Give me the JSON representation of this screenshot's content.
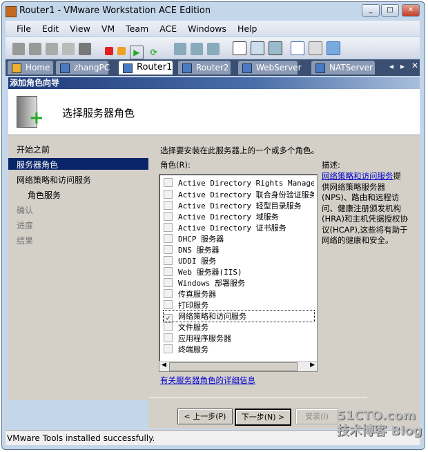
{
  "window": {
    "title": "Router1 - VMware Workstation ACE Edition"
  },
  "menu": [
    "File",
    "Edit",
    "View",
    "VM",
    "Team",
    "ACE",
    "Windows",
    "Help"
  ],
  "tabs": [
    {
      "label": "Home"
    },
    {
      "label": "zhangPC"
    },
    {
      "label": "Router1"
    },
    {
      "label": "Router2"
    },
    {
      "label": "WebServer"
    },
    {
      "label": "NATServer"
    }
  ],
  "wizard": {
    "title": "添加角色向导",
    "heading": "选择服务器角色",
    "nav": [
      "开始之前",
      "服务器角色",
      "网络策略和访问服务",
      "角色服务",
      "确认",
      "进度",
      "结果"
    ],
    "instruction": "选择要安装在此服务器上的一个或多个角色。",
    "roles_label": "角色(R):",
    "roles": [
      {
        "label": "Active Directory Rights Management",
        "checked": false
      },
      {
        "label": "Active Directory 联合身份验证服务",
        "checked": false
      },
      {
        "label": "Active Directory 轻型目录服务",
        "checked": false
      },
      {
        "label": "Active Directory 域服务",
        "checked": false
      },
      {
        "label": "Active Directory 证书服务",
        "checked": false
      },
      {
        "label": "DHCP 服务器",
        "checked": false
      },
      {
        "label": "DNS 服务器",
        "checked": false
      },
      {
        "label": "UDDI 服务",
        "checked": false
      },
      {
        "label": "Web 服务器(IIS)",
        "checked": false
      },
      {
        "label": "Windows 部署服务",
        "checked": false
      },
      {
        "label": "传真服务器",
        "checked": false
      },
      {
        "label": "打印服务",
        "checked": false
      },
      {
        "label": "网络策略和访问服务",
        "checked": true
      },
      {
        "label": "文件服务",
        "checked": false
      },
      {
        "label": "应用程序服务器",
        "checked": false
      },
      {
        "label": "终端服务",
        "checked": false
      }
    ],
    "desc_label": "描述:",
    "desc_link": "网络策略和访问服务",
    "desc_text": "提供网络策略服务器(NPS)、路由和远程访问、健康注册颁发机构(HRA)和主机凭据授权协议(HCAP),这些将有助于网络的健康和安全。",
    "more_link": "有关服务器角色的详细信息",
    "buttons": {
      "prev": "< 上一步(P)",
      "next": "下一步(N) >",
      "install": "安装(I)"
    }
  },
  "status": "VMware Tools installed successfully.",
  "watermark": "51CTO.com 技术博客 Blog"
}
